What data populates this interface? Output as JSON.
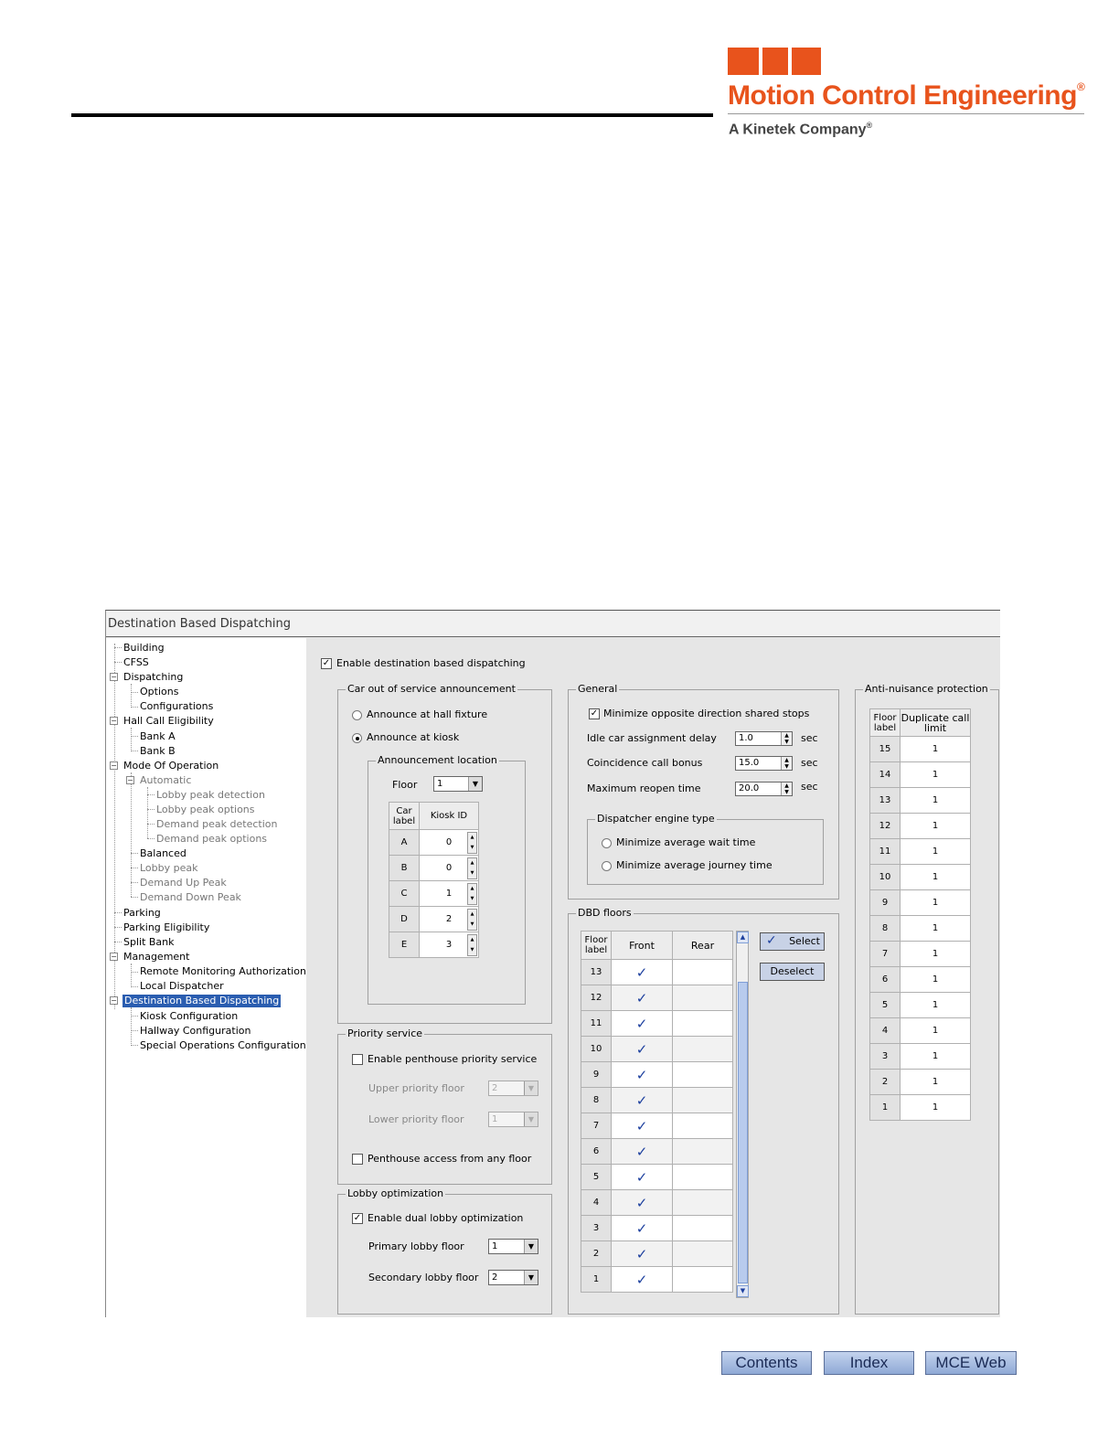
{
  "brand": {
    "name": "Motion Control Engineering",
    "registered": "®",
    "tagline": "A Kinetek Company",
    "tagline_reg": "®",
    "accent_color": "#e8531c"
  },
  "window": {
    "title": "Destination Based Dispatching"
  },
  "tree": {
    "building": "Building",
    "cfss": "CFSS",
    "dispatching": "Dispatching",
    "options": "Options",
    "configurations": "Configurations",
    "hall_call": "Hall Call Eligibility",
    "bank_a": "Bank A",
    "bank_b": "Bank B",
    "mode": "Mode Of Operation",
    "automatic": "Automatic",
    "lobby_peak_detection": "Lobby peak detection",
    "lobby_peak_options": "Lobby peak options",
    "demand_peak_detection": "Demand peak detection",
    "demand_peak_options": "Demand peak options",
    "balanced": "Balanced",
    "lobby_peak": "Lobby peak",
    "demand_up": "Demand Up Peak",
    "demand_down": "Demand Down Peak",
    "parking": "Parking",
    "parking_elig": "Parking Eligibility",
    "split_bank": "Split Bank",
    "management": "Management",
    "remote": "Remote Monitoring Authorization",
    "local": "Local Dispatcher",
    "dbd": "Destination Based Dispatching",
    "kiosk": "Kiosk Configuration",
    "hallway": "Hallway Configuration",
    "special": "Special Operations Configuration"
  },
  "main": {
    "enable_dbd": "Enable destination based dispatching",
    "cos": {
      "title": "Car out of service announcement",
      "hall": "Announce at hall fixture",
      "kiosk": "Announce at kiosk",
      "loc_title": "Announcement location",
      "floor_label": "Floor",
      "floor_value": "1",
      "col_car": "Car label",
      "col_kiosk": "Kiosk ID",
      "rows": [
        {
          "car": "A",
          "kiosk": "0"
        },
        {
          "car": "B",
          "kiosk": "0"
        },
        {
          "car": "C",
          "kiosk": "1"
        },
        {
          "car": "D",
          "kiosk": "2"
        },
        {
          "car": "E",
          "kiosk": "3"
        }
      ]
    },
    "priority": {
      "title": "Priority service",
      "enable": "Enable penthouse priority service",
      "upper": "Upper priority floor",
      "upper_value": "2",
      "lower": "Lower priority floor",
      "lower_value": "1",
      "any_floor": "Penthouse access from any floor"
    },
    "lobby": {
      "title": "Lobby optimization",
      "enable": "Enable dual lobby optimization",
      "primary": "Primary lobby floor",
      "primary_value": "1",
      "secondary": "Secondary lobby floor",
      "secondary_value": "2"
    },
    "general": {
      "title": "General",
      "minimize": "Minimize opposite direction shared stops",
      "idle": "Idle car assignment delay",
      "idle_value": "1.0",
      "coincidence": "Coincidence call bonus",
      "coincidence_value": "15.0",
      "reopen": "Maximum reopen time",
      "reopen_value": "20.0",
      "unit": "sec",
      "engine_title": "Dispatcher engine type",
      "engine_wait": "Minimize average wait time",
      "engine_journey": "Minimize average journey time"
    },
    "dbd_floors": {
      "title": "DBD floors",
      "col_floor": "Floor label",
      "col_front": "Front",
      "col_rear": "Rear",
      "floors": [
        "13",
        "12",
        "11",
        "10",
        "9",
        "8",
        "7",
        "6",
        "5",
        "4",
        "3",
        "2",
        "1"
      ],
      "check": "✓",
      "select": "Select",
      "deselect": "Deselect"
    },
    "anti": {
      "title": "Anti-nuisance protection",
      "col_floor": "Floor label",
      "col_limit": "Duplicate call limit",
      "rows": [
        {
          "floor": "15",
          "limit": "1"
        },
        {
          "floor": "14",
          "limit": "1"
        },
        {
          "floor": "13",
          "limit": "1"
        },
        {
          "floor": "12",
          "limit": "1"
        },
        {
          "floor": "11",
          "limit": "1"
        },
        {
          "floor": "10",
          "limit": "1"
        },
        {
          "floor": "9",
          "limit": "1"
        },
        {
          "floor": "8",
          "limit": "1"
        },
        {
          "floor": "7",
          "limit": "1"
        },
        {
          "floor": "6",
          "limit": "1"
        },
        {
          "floor": "5",
          "limit": "1"
        },
        {
          "floor": "4",
          "limit": "1"
        },
        {
          "floor": "3",
          "limit": "1"
        },
        {
          "floor": "2",
          "limit": "1"
        },
        {
          "floor": "1",
          "limit": "1"
        }
      ]
    }
  },
  "footer": {
    "contents": "Contents",
    "index": "Index",
    "web": "MCE Web"
  }
}
